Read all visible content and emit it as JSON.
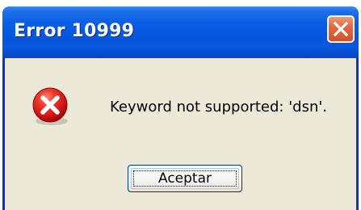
{
  "dialog": {
    "title": "Error 10999",
    "message": "Keyword not supported: 'dsn'.",
    "ok_label": "Aceptar",
    "close_icon": "close-icon",
    "status_icon": "error-icon"
  },
  "colors": {
    "titlebar": "#0a5ee4",
    "body": "#ece9d8",
    "close_button": "#e06a44",
    "error_icon": "#e02020"
  }
}
